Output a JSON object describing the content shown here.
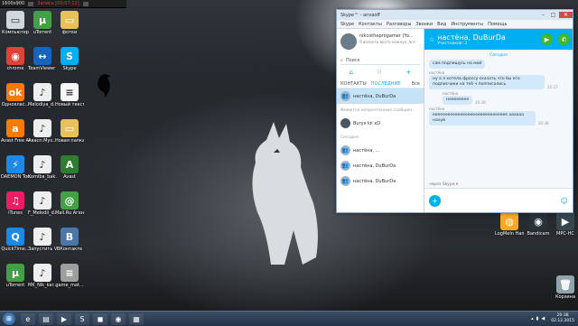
{
  "recording_bar": {
    "resolution": "1600x900",
    "record_label": "Запись [00:07:12]"
  },
  "desktop_icons": [
    {
      "label": "Компьютер",
      "color": "#cfd8dc",
      "glyph": "▭"
    },
    {
      "label": "uTorrent",
      "color": "#43a047",
      "glyph": "µ"
    },
    {
      "label": "фотки",
      "color": "#e8c15a",
      "glyph": "▭"
    },
    {
      "label": "chrome",
      "color": "#db4437",
      "glyph": "◉"
    },
    {
      "label": "TeamViewer 9",
      "color": "#1565c0",
      "glyph": "↔"
    },
    {
      "label": "Skype",
      "color": "#00aff0",
      "glyph": "S"
    },
    {
      "label": "Одноклас...",
      "color": "#f57c00",
      "glyph": "ok"
    },
    {
      "label": "Melodiya_d...",
      "color": "#eeeeee",
      "glyph": "♪"
    },
    {
      "label": "Новый текстов...",
      "color": "#f5f5f5",
      "glyph": "≡"
    },
    {
      "label": "Avast Free Antivirus",
      "color": "#f57c00",
      "glyph": "a"
    },
    {
      "label": "Авасп.Муз...",
      "color": "#eeeeee",
      "glyph": "♪"
    },
    {
      "label": "Новая папка",
      "color": "#e8c15a",
      "glyph": "▭"
    },
    {
      "label": "DAEMON Tools Lite",
      "color": "#1e88e5",
      "glyph": "⚡"
    },
    {
      "label": "Komiba_bak...",
      "color": "#eeeeee",
      "glyph": "♪"
    },
    {
      "label": "Avast",
      "color": "#2e7d32",
      "glyph": "A"
    },
    {
      "label": "iTunes",
      "color": "#e91e63",
      "glyph": "♫"
    },
    {
      "label": "F_Melodii_d...",
      "color": "#eeeeee",
      "glyph": "♪"
    },
    {
      "label": "Mail.Ru Агент",
      "color": "#43a047",
      "glyph": "@"
    },
    {
      "label": "QuickTime...",
      "color": "#1e88e5",
      "glyph": "Q"
    },
    {
      "label": "Запустить VKontakteDJ",
      "color": "#eeeeee",
      "glyph": "♪"
    },
    {
      "label": "ВКонтакте",
      "color": "#4a76a8",
      "glyph": "B"
    },
    {
      "label": "uTorrent",
      "color": "#43a047",
      "glyph": "µ"
    },
    {
      "label": "MK_Nik_kar...",
      "color": "#eeeeee",
      "glyph": "♪"
    },
    {
      "label": "game_mat...",
      "color": "#9e9e9e",
      "glyph": "≡"
    }
  ],
  "right_icons": [
    {
      "label": "LogMeIn Hamachi",
      "color": "#f9a825",
      "glyph": "◍"
    },
    {
      "label": "Bandicam",
      "color": "#263238",
      "glyph": "◉"
    },
    {
      "label": "MPC-HC",
      "color": "#37474f",
      "glyph": "▶"
    },
    {
      "label": "Корзина",
      "color": "#90a4ae",
      "glyph": "🗑"
    }
  ],
  "skype": {
    "title": "Skype™ - anvaoff",
    "menu": [
      "Skype",
      "Контакты",
      "Разговоры",
      "Звонки",
      "Вид",
      "Инструменты",
      "Помощь"
    ],
    "profile_name": "nikcotheprogamer (Yo...",
    "profile_status": "Я волонтр вкото нежнуя. Acе",
    "search_placeholder": "Поиск",
    "tabs": {
      "contacts": "КОНТАКТЫ",
      "recent": "ПОСЛЕДНИЕ",
      "all": "Все"
    },
    "contacts": [
      {
        "name": "настёна, DuBurDa",
        "selected": true
      },
      {
        "name": "Burys lol xD",
        "selected": false
      },
      {
        "name": "настёна, ...",
        "selected": false
      },
      {
        "name": "настёна, DuBurDa",
        "selected": false
      },
      {
        "name": "настёна, DuBurDa",
        "selected": false
      }
    ],
    "section_unread": "Имеются непрочтенные сообщен...",
    "section_today": "Сегодня",
    "chat_title": "настёна, DuBurDa",
    "chat_subtitle": "Участников: 2",
    "date_label": "Сегодня",
    "messages": [
      {
        "who": "",
        "text": "сам подпишусь на мой",
        "time": ""
      },
      {
        "who": "настёна",
        "text": "ну а я хотела фроссу сказать что бы его подписчики на теб ч попписались",
        "time": "20:37"
      },
      {
        "who": "настёна",
        "text": "нееееееее",
        "time": "20:38"
      },
      {
        "who": "настёна",
        "text": "ееееееееееееееееееееееееееееее аааааа нахуй",
        "time": "20:38"
      }
    ],
    "via_label": "через Skype ▾",
    "compose_placeholder": ""
  },
  "taskbar": {
    "items": [
      "e",
      "▤",
      "▶",
      "S",
      "◼",
      "◉",
      "▦"
    ],
    "clock_time": "20:38",
    "clock_date": "02.12.2015"
  }
}
